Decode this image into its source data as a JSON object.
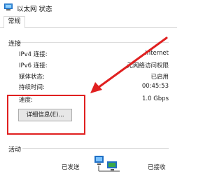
{
  "window": {
    "title": "以太网 状态"
  },
  "tabs": [
    {
      "label": "常规"
    }
  ],
  "connection": {
    "title": "连接",
    "rows": [
      {
        "label": "IPv4 连接:",
        "value": "Internet"
      },
      {
        "label": "IPv6 连接:",
        "value": "无网络访问权限"
      },
      {
        "label": "媒体状态:",
        "value": "已启用"
      },
      {
        "label": "持续时间:",
        "value": "00:45:53"
      },
      {
        "label": "速度:",
        "value": "1.0 Gbps"
      }
    ],
    "details_button": "详细信息(E)..."
  },
  "activity": {
    "title": "活动",
    "sent_label": "已发送",
    "received_label": "已接收"
  },
  "colors": {
    "highlight": "#e02020",
    "arrow": "#e02020",
    "icon_blue": "#1f6fc5",
    "monitor_green": "#3aa84a"
  },
  "icons": {
    "app": "network-adapter-icon",
    "activity": "network-computers-icon",
    "annotation": "red-arrow"
  }
}
